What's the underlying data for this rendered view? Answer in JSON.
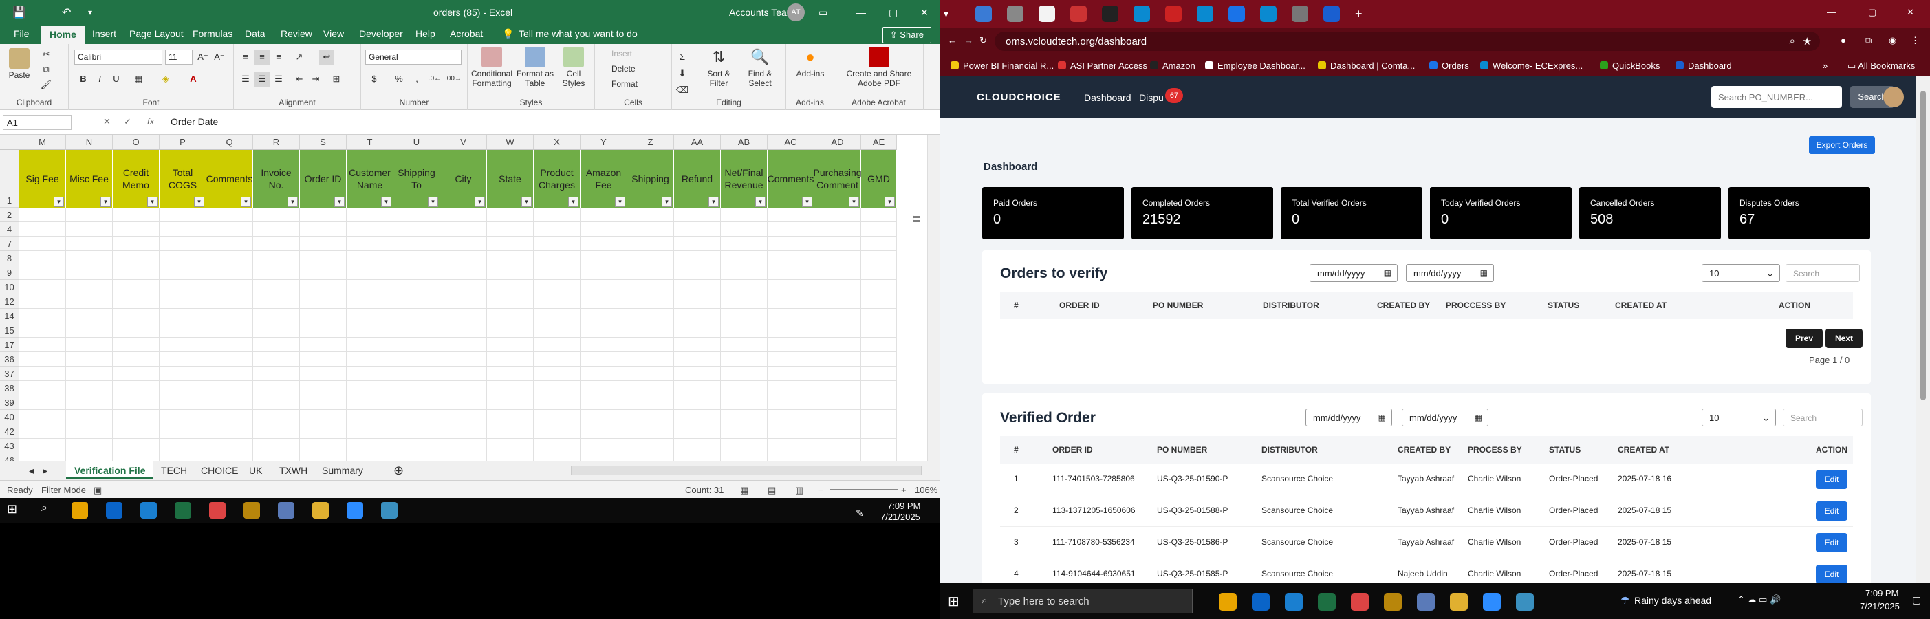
{
  "excel": {
    "window_title": "orders (85)  -  Excel",
    "account": "Accounts Team",
    "avatar_initials": "AT",
    "tabs": [
      "File",
      "Home",
      "Insert",
      "Page Layout",
      "Formulas",
      "Data",
      "Review",
      "View",
      "Developer",
      "Help",
      "Acrobat"
    ],
    "active_tab": "Home",
    "tell_me": "Tell me what you want to do",
    "share": "Share",
    "ribbon": {
      "clipboard": "Clipboard",
      "font_name": "Calibri",
      "font_size": "11",
      "font": "Font",
      "alignment": "Alignment",
      "number_format": "General",
      "number": "Number",
      "conditional": "Conditional Formatting",
      "format_table": "Format as Table",
      "cell_styles": "Cell Styles",
      "styles": "Styles",
      "insert": "Insert",
      "delete": "Delete",
      "format": "Format",
      "cells": "Cells",
      "sort_filter": "Sort & Filter",
      "find_select": "Find & Select",
      "editing": "Editing",
      "addins": "Add-ins",
      "addins_group": "Add-ins",
      "create_share": "Create and Share Adobe PDF",
      "adobe": "Adobe Acrobat"
    },
    "name_box": "A1",
    "formula": "Order Date",
    "columns": [
      "M",
      "N",
      "O",
      "P",
      "Q",
      "R",
      "S",
      "T",
      "U",
      "V",
      "W",
      "X",
      "Y",
      "Z",
      "AA",
      "AB",
      "AC",
      "AD",
      "AE"
    ],
    "header_cells": [
      "Sig Fee",
      "Misc Fee",
      "Credit Memo",
      "Total COGS",
      "Comments",
      "Invoice No.",
      "Order ID",
      "Customer Name",
      "Shipping To",
      "City",
      "State",
      "Product Charges",
      "Amazon Fee",
      "Shipping",
      "Refund",
      "Net/Final Revenue",
      "Comments",
      "Purchasing Comment",
      "GMD"
    ],
    "rows": [
      "1",
      "2",
      "4",
      "7",
      "8",
      "9",
      "10",
      "12",
      "14",
      "15",
      "17",
      "36",
      "37",
      "38",
      "39",
      "40",
      "42",
      "43",
      "46"
    ],
    "sheets": [
      "Verification File",
      "TECH",
      "CHOICE",
      "UK",
      "TXWH",
      "Summary"
    ],
    "active_sheet": "Verification File",
    "status_ready": "Ready",
    "status_filter": "Filter Mode",
    "count": "Count: 31",
    "zoom": "106%",
    "time": "7:09 PM",
    "date": "7/21/2025"
  },
  "browser": {
    "url": "oms.vcloudtech.org/dashboard",
    "bookmarks": [
      "Power BI Financial R...",
      "ASI Partner Access",
      "Amazon",
      "Employee Dashboar...",
      "Dashboard | Comta...",
      "Orders",
      "Welcome- ECExpres...",
      "QuickBooks",
      "Dashboard"
    ],
    "all_bookmarks": "All Bookmarks"
  },
  "app": {
    "logo": "CLOUDCHOICE",
    "nav": [
      "Dashboard",
      "Dispu"
    ],
    "dispute_badge": "67",
    "search_placeholder": "Search PO_NUMBER...",
    "search_button": "Search",
    "export_button": "Export Orders",
    "heading": "Dashboard",
    "stats": [
      {
        "label": "Paid Orders",
        "value": "0"
      },
      {
        "label": "Completed Orders",
        "value": "21592"
      },
      {
        "label": "Total Verified Orders",
        "value": "0"
      },
      {
        "label": "Today Verified Orders",
        "value": "0"
      },
      {
        "label": "Cancelled Orders",
        "value": "508"
      },
      {
        "label": "Disputes Orders",
        "value": "67"
      }
    ],
    "date_placeholder": "mm/dd/yyyy",
    "page_size": "10",
    "search_small": "Search",
    "verify": {
      "title": "Orders to verify",
      "headers": [
        "#",
        "ORDER ID",
        "PO NUMBER",
        "DISTRIBUTOR",
        "CREATED BY",
        "PROCCESS BY",
        "STATUS",
        "CREATED AT",
        "ACTION"
      ],
      "prev": "Prev",
      "next": "Next",
      "page_info": "Page 1 / 0"
    },
    "verified": {
      "title": "Verified Order",
      "headers": [
        "#",
        "ORDER ID",
        "PO NUMBER",
        "DISTRIBUTOR",
        "CREATED BY",
        "PROCESS BY",
        "STATUS",
        "CREATED AT",
        "ACTION"
      ],
      "edit": "Edit",
      "rows": [
        [
          "1",
          "111-7401503-7285806",
          "US-Q3-25-01590-P",
          "Scansource Choice",
          "Tayyab Ashraaf",
          "Charlie Wilson",
          "Order-Placed",
          "2025-07-18 16"
        ],
        [
          "2",
          "113-1371205-1650606",
          "US-Q3-25-01588-P",
          "Scansource Choice",
          "Tayyab Ashraaf",
          "Charlie Wilson",
          "Order-Placed",
          "2025-07-18 15"
        ],
        [
          "3",
          "111-7108780-5356234",
          "US-Q3-25-01586-P",
          "Scansource Choice",
          "Tayyab Ashraaf",
          "Charlie Wilson",
          "Order-Placed",
          "2025-07-18 15"
        ],
        [
          "4",
          "114-9104644-6930651",
          "US-Q3-25-01585-P",
          "Scansource Choice",
          "Najeeb Uddin",
          "Charlie Wilson",
          "Order-Placed",
          "2025-07-18 15"
        ]
      ]
    }
  },
  "taskbar": {
    "search_placeholder": "Type here to search",
    "weather": "Rainy days ahead",
    "time": "7:09 PM",
    "date": "7/21/2025"
  },
  "colors": {
    "excel_green": "#217346",
    "header_yellow": "#cccc00",
    "header_green": "#70ad47",
    "nav_dark": "#1e2a3a",
    "accent_blue": "#1a6fe0"
  }
}
